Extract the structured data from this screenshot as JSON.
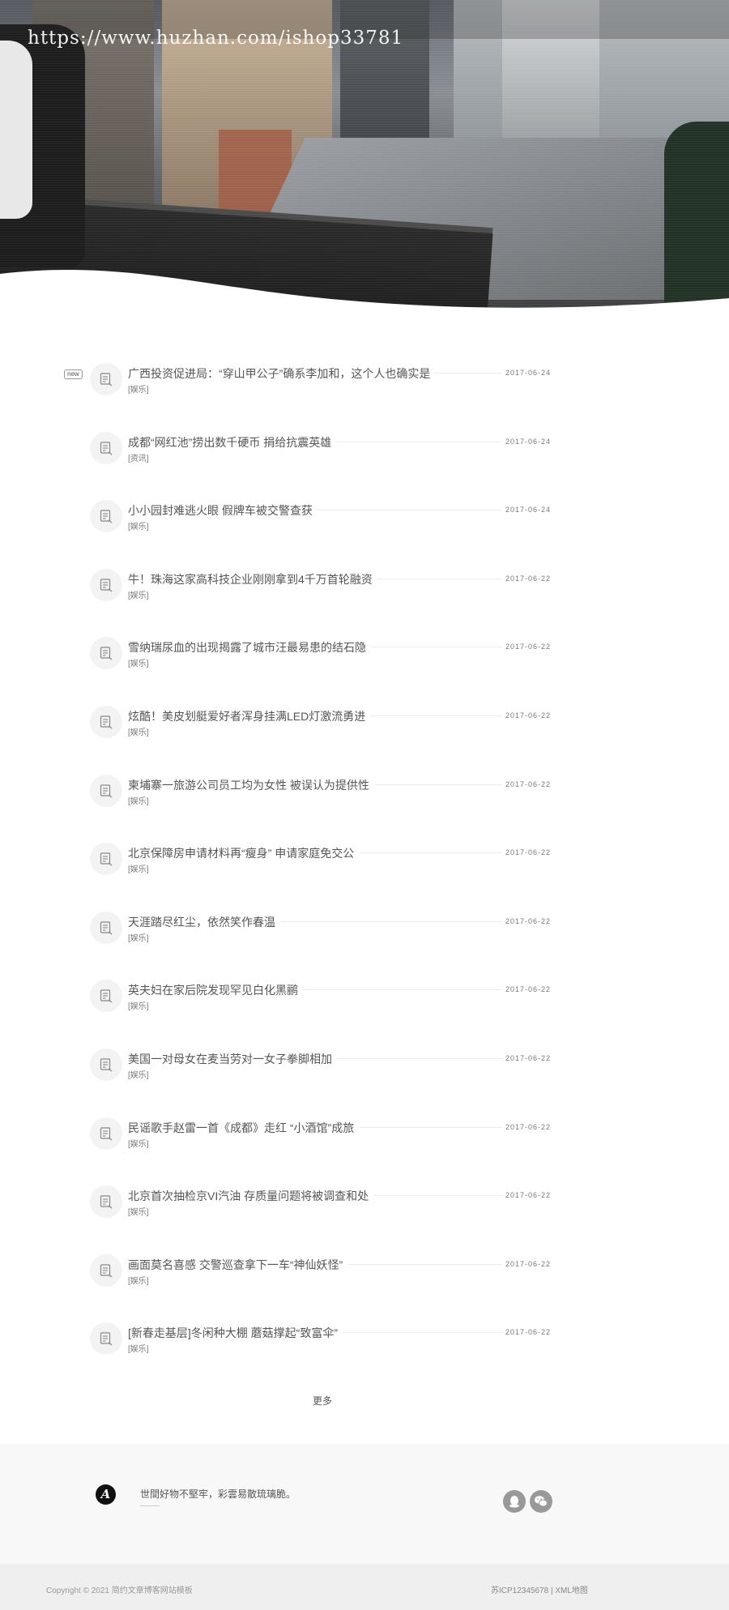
{
  "watermark_url": "https://www.huzhan.com/ishop33781",
  "articles": [
    {
      "title": "广西投资促进局：“穿山甲公子”确系李加和，这个人也确实是",
      "category": "[娱乐]",
      "date": "2017-06-24",
      "badge": "new"
    },
    {
      "title": "成都“网红池”捞出数千硬币 捐给抗震英雄",
      "category": "[资讯]",
      "date": "2017-06-24"
    },
    {
      "title": "小小园封难逃火眼 假牌车被交警查获",
      "category": "[娱乐]",
      "date": "2017-06-24"
    },
    {
      "title": "牛！珠海这家高科技企业刚刚拿到4千万首轮融资",
      "category": "[娱乐]",
      "date": "2017-06-22"
    },
    {
      "title": "雪纳瑞尿血的出现揭露了城市汪最易患的结石隐",
      "category": "[娱乐]",
      "date": "2017-06-22"
    },
    {
      "title": "炫酷！美皮划艇爱好者浑身挂满LED灯激流勇进",
      "category": "[娱乐]",
      "date": "2017-06-22"
    },
    {
      "title": "柬埔寨一旅游公司员工均为女性 被误认为提供性",
      "category": "[娱乐]",
      "date": "2017-06-22"
    },
    {
      "title": "北京保障房申请材料再“瘦身” 申请家庭免交公",
      "category": "[娱乐]",
      "date": "2017-06-22"
    },
    {
      "title": "天涯踏尽红尘，依然笑作春温",
      "category": "[娱乐]",
      "date": "2017-06-22"
    },
    {
      "title": "英夫妇在家后院发现罕见白化黑鹂",
      "category": "[娱乐]",
      "date": "2017-06-22"
    },
    {
      "title": "美国一对母女在麦当劳对一女子拳脚相加",
      "category": "[娱乐]",
      "date": "2017-06-22"
    },
    {
      "title": "民谣歌手赵雷一首《成都》走红 “小酒馆”成旅",
      "category": "[娱乐]",
      "date": "2017-06-22"
    },
    {
      "title": "北京首次抽检京VI汽油 存质量问题将被调查和处",
      "category": "[娱乐]",
      "date": "2017-06-22"
    },
    {
      "title": "画面莫名喜感 交警巡查拿下一车“神仙妖怪”",
      "category": "[娱乐]",
      "date": "2017-06-22"
    },
    {
      "title": "[新春走基层]冬闲种大棚 蘑菇撑起“致富伞”",
      "category": "[娱乐]",
      "date": "2017-06-22"
    }
  ],
  "more_label": "更多",
  "footer": {
    "logo_letter": "A",
    "slogan": "世間好物不堅牢，彩雲易散琉璃脆。",
    "social_icons": [
      "qq-icon",
      "wechat-icon"
    ]
  },
  "copyright": "Copyright © 2021 简约文章博客网站模板",
  "icp": "苏ICP12345678 | XML地图",
  "colors": {
    "text": "#555555",
    "muted": "#999999",
    "footer_bg": "#f8f8f8",
    "copy_bg": "#efefef"
  }
}
